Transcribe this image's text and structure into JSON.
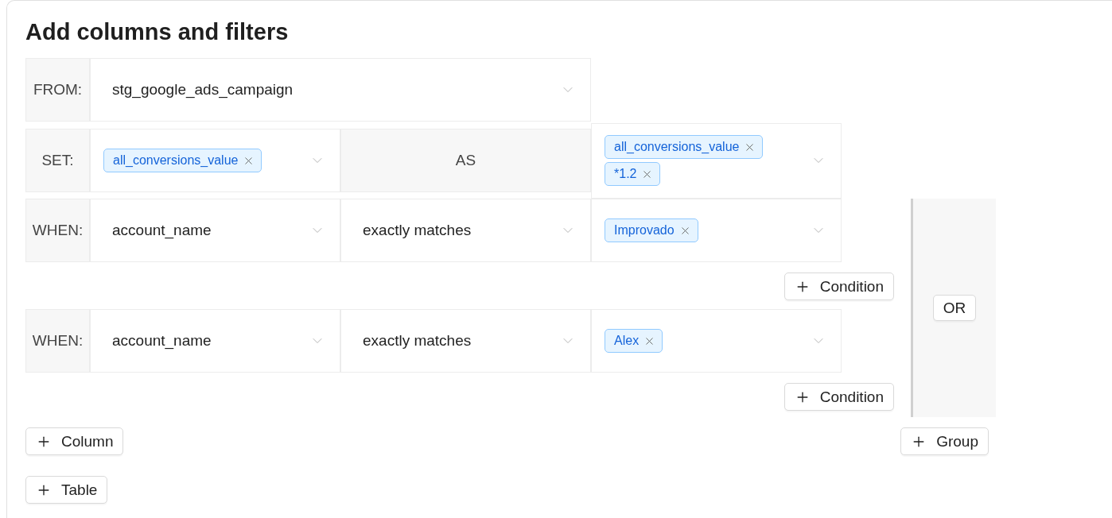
{
  "title": "Add columns and filters",
  "from": {
    "label": "FROM:",
    "value": "stg_google_ads_campaign"
  },
  "set": {
    "label": "SET:",
    "columns": [
      "all_conversions_value"
    ],
    "as_label": "AS",
    "expression": [
      "all_conversions_value",
      "*1.2"
    ]
  },
  "groups": [
    {
      "conditions": [
        {
          "label": "WHEN:",
          "field": "account_name",
          "operator": "exactly matches",
          "values": [
            "Improvado"
          ]
        }
      ],
      "add_condition": "Condition"
    },
    {
      "conditions": [
        {
          "label": "WHEN:",
          "field": "account_name",
          "operator": "exactly matches",
          "values": [
            "Alex"
          ]
        }
      ],
      "add_condition": "Condition"
    }
  ],
  "or_label": "OR",
  "add_column": "Column",
  "add_group": "Group",
  "add_table": "Table"
}
